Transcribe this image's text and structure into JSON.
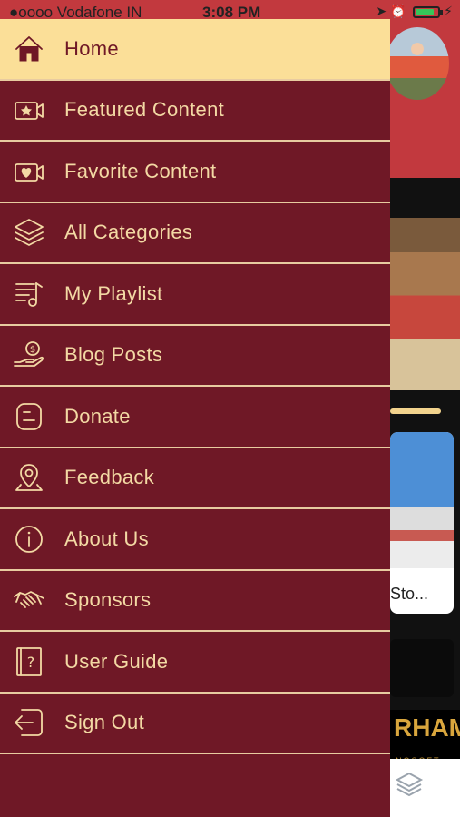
{
  "status_bar": {
    "carrier": "●oooo Vodafone IN",
    "time": "3:08 PM",
    "wifi_icon": "wifi-icon",
    "location_icon": "location-arrow-icon",
    "alarm_icon": "alarm-icon",
    "battery_level_pct": 75,
    "battery_color": "#35c759"
  },
  "drawer": {
    "colors": {
      "background": "#6f1826",
      "active_background": "#fbdf98",
      "text": "#f3d9a4",
      "divider": "#e8cba0"
    },
    "items": [
      {
        "label": "Home",
        "icon": "home-icon",
        "active": true
      },
      {
        "label": "Featured Content",
        "icon": "featured-star-icon",
        "active": false
      },
      {
        "label": "Favorite Content",
        "icon": "favorite-heart-icon",
        "active": false
      },
      {
        "label": "All Categories",
        "icon": "layers-icon",
        "active": false
      },
      {
        "label": "My Playlist",
        "icon": "playlist-icon",
        "active": false
      },
      {
        "label": "Blog Posts",
        "icon": "hand-money-icon",
        "active": false
      },
      {
        "label": "Donate",
        "icon": "blogger-icon",
        "active": false
      },
      {
        "label": "Feedback",
        "icon": "map-pin-icon",
        "active": false
      },
      {
        "label": "About Us",
        "icon": "info-icon",
        "active": false
      },
      {
        "label": "Sponsors",
        "icon": "handshake-icon",
        "active": false
      },
      {
        "label": "User Guide",
        "icon": "guide-book-icon",
        "active": false
      },
      {
        "label": "Sign Out",
        "icon": "sign-out-icon",
        "active": false
      }
    ]
  },
  "background": {
    "card_text": "Sto...",
    "brand_text": "RHAM",
    "brand_sub": "NOSOFT",
    "tab_icon": "layers-tab-icon"
  }
}
